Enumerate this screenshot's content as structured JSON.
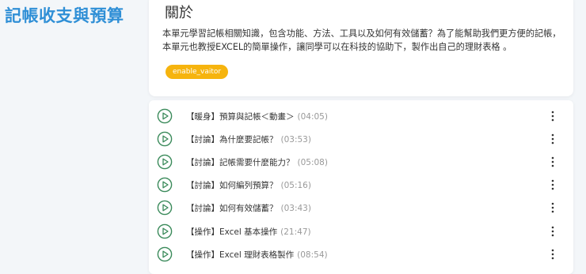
{
  "course": {
    "title": "記帳收支與預算"
  },
  "about": {
    "heading": "關於",
    "description": "本單元學習記帳相關知識，包含功能、方法、工具以及如何有效儲蓄？為了能幫助我們更方便的記帳，本單元也教授EXCEL的簡單操作，讓同學可以在科技的協助下，製作出自己的理財表格 。",
    "badge": "enable_vaitor"
  },
  "lessons": [
    {
      "title": "【暖身】預算與記帳＜動畫＞",
      "duration": "(04:05)"
    },
    {
      "title": "【討論】為什麼要記帳？",
      "duration": "(03:53)"
    },
    {
      "title": "【討論】記帳需要什麼能力？",
      "duration": "(05:08)"
    },
    {
      "title": "【討論】如何編列預算？",
      "duration": "(05:16)"
    },
    {
      "title": "【討論】如何有效儲蓄？",
      "duration": "(03:43)"
    },
    {
      "title": "【操作】Excel 基本操作",
      "duration": "(21:47)"
    },
    {
      "title": "【操作】Excel 理財表格製作",
      "duration": "(08:54)"
    }
  ],
  "icons": {
    "play": "play-circle-icon",
    "more": "more-vertical-icon"
  },
  "colors": {
    "title": "#2f8fd6",
    "badge": "#f6b40e",
    "play_icon": "#3a8a5a"
  }
}
